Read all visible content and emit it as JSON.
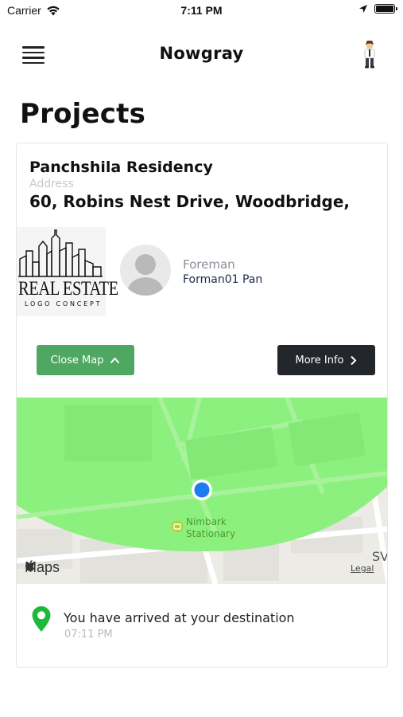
{
  "status_bar": {
    "carrier": "Carrier",
    "time": "7:11 PM"
  },
  "header": {
    "title": "Nowgray",
    "menu_icon": "hamburger-menu-icon",
    "profile_icon": "user-avatar-icon"
  },
  "page": {
    "title": "Projects"
  },
  "project": {
    "name": "Panchshila Residency",
    "address_label": "Address",
    "address": "60, Robins Nest Drive, Woodbridge,",
    "logo_text": "REAL ESTATE",
    "logo_subtext": "LOGO CONCEPT",
    "foreman_label": "Foreman",
    "foreman_name": "Forman01 Pan",
    "close_map_label": "Close Map",
    "more_info_label": "More Info"
  },
  "map": {
    "attribution": "Maps",
    "legal": "Legal",
    "poi_name_line1": "Nimbark",
    "poi_name_line2": "Stationary",
    "edge_label": "SV",
    "geofence_color": "#8cf07e",
    "location_dot_color": "#1d7cf2"
  },
  "arrival": {
    "message": "You have arrived at your destination",
    "time": "07:11 PM",
    "pin_color": "#1fb83a"
  },
  "colors": {
    "close_map_button": "#4fa861",
    "more_info_button": "#23272c"
  }
}
